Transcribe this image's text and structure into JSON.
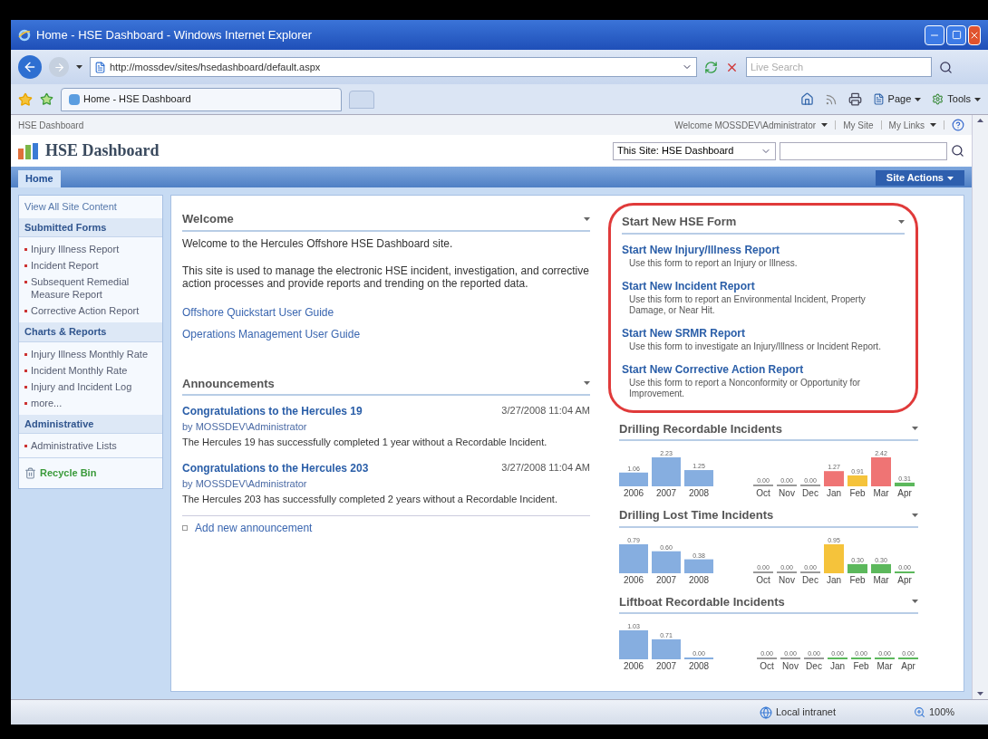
{
  "window": {
    "title": "Home - HSE Dashboard - Windows Internet Explorer"
  },
  "address_bar": {
    "url": "http://mossdev/sites/hsedashboard/default.aspx"
  },
  "search": {
    "placeholder": "Live Search"
  },
  "tabs": [
    {
      "label": "Home - HSE Dashboard",
      "selected": true
    }
  ],
  "command_bar": [
    "Page",
    "Tools"
  ],
  "site": {
    "breadcrumb": "HSE Dashboard",
    "welcome": "Welcome MOSSDEV\\Administrator",
    "top_links": [
      "My Site",
      "My Links"
    ],
    "title": "HSE Dashboard",
    "search_scope": "This Site: HSE Dashboard"
  },
  "top_nav": [
    {
      "label": "Home",
      "selected": true
    }
  ],
  "site_actions": "Site Actions",
  "quick_launch": {
    "view_all": "View All Site Content",
    "sections": [
      {
        "heading": "Submitted Forms",
        "items": [
          "Injury Illness Report",
          "Incident Report",
          "Subsequent Remedial Measure Report",
          "Corrective Action Report"
        ]
      },
      {
        "heading": "Charts & Reports",
        "items": [
          "Injury Illness Monthly Rate",
          "Incident Monthly Rate",
          "Injury and Incident Log",
          "more..."
        ]
      },
      {
        "heading": "Administrative",
        "items": [
          "Administrative Lists"
        ]
      }
    ],
    "recycle_bin": "Recycle Bin"
  },
  "welcome": {
    "title": "Welcome",
    "paragraphs": [
      "Welcome to the Hercules Offshore HSE Dashboard site.",
      "This site is used to manage the electronic HSE incident, investigation, and corrective action processes and provide reports and trending on the reported data."
    ],
    "links": [
      "Offshore Quickstart User Guide",
      "Operations Management User Guide"
    ]
  },
  "announcements": {
    "title": "Announcements",
    "items": [
      {
        "title": "Congratulations to the Hercules 19",
        "date": "3/27/2008 11:04 AM",
        "author": "by MOSSDEV\\Administrator",
        "body": "The Hercules 19 has successfully completed 1 year without a Recordable Incident."
      },
      {
        "title": "Congratulations to the Hercules 203",
        "date": "3/27/2008 11:04 AM",
        "author": "by MOSSDEV\\Administrator",
        "body": "The Hercules 203 has successfully completed 2 years without a Recordable Incident."
      }
    ],
    "add": "Add new announcement"
  },
  "hse_form": {
    "title": "Start New HSE Form",
    "highlighted": true,
    "items": [
      {
        "title": "Start New Injury/Illness Report",
        "description": "Use this form to report an Injury or Illness."
      },
      {
        "title": "Start New Incident Report",
        "description": "Use this form to report an Environmental Incident, Property Damage, or Near Hit."
      },
      {
        "title": "Start New SRMR Report",
        "description": "Use this form to investigate an Injury/Illness or Incident Report."
      },
      {
        "title": "Start New Corrective Action Report",
        "description": "Use this form to report a Nonconformity or Opportunity for Improvement."
      }
    ]
  },
  "charts": [
    {
      "title": "Drilling Recordable Incidents",
      "yearly": {
        "chart_data": {
          "type": "bar",
          "categories": [
            "2006",
            "2007",
            "2008"
          ],
          "data_labels": true,
          "series": [
            {
              "color": "#86aee0",
              "values": [
                1.06,
                2.23,
                1.25
              ],
              "value_labels": [
                "1.06",
                "2.23",
                "1.25"
              ]
            }
          ]
        }
      },
      "monthly": {
        "chart_data": {
          "type": "bar",
          "stacked": true,
          "data_labels": true,
          "categories": [
            "Oct",
            "Nov",
            "Dec",
            "Jan",
            "Feb",
            "Mar",
            "Apr"
          ],
          "series": [
            {
              "color": "#999999",
              "values": [
                0,
                0,
                0,
                null,
                null,
                null,
                null
              ],
              "value_labels": [
                "0.00",
                "0.00",
                "0.00",
                null,
                null,
                null,
                null
              ]
            },
            {
              "color": "#ef7474",
              "values": [
                null,
                null,
                null,
                1.27,
                null,
                2.42,
                null
              ],
              "value_labels": [
                null,
                null,
                null,
                "1.27",
                null,
                "2.42",
                null
              ]
            },
            {
              "color": "#f5c33b",
              "values": [
                null,
                null,
                null,
                null,
                0.91,
                null,
                null
              ],
              "value_labels": [
                null,
                null,
                null,
                null,
                "0.91",
                null,
                null
              ]
            },
            {
              "color": "#5cb85c",
              "values": [
                null,
                null,
                null,
                null,
                null,
                null,
                0.31
              ],
              "value_labels": [
                null,
                null,
                null,
                null,
                null,
                null,
                "0.31"
              ]
            }
          ]
        }
      }
    },
    {
      "title": "Drilling Lost Time Incidents",
      "yearly": {
        "chart_data": {
          "type": "bar",
          "categories": [
            "2006",
            "2007",
            "2008"
          ],
          "data_labels": true,
          "series": [
            {
              "color": "#86aee0",
              "values": [
                0.79,
                0.6,
                0.38
              ],
              "value_labels": [
                "0.79",
                "0.60",
                "0.38"
              ]
            }
          ]
        }
      },
      "monthly": {
        "chart_data": {
          "type": "bar",
          "stacked": true,
          "data_labels": true,
          "categories": [
            "Oct",
            "Nov",
            "Dec",
            "Jan",
            "Feb",
            "Mar",
            "Apr"
          ],
          "series": [
            {
              "color": "#999999",
              "values": [
                0,
                0,
                0,
                null,
                null,
                null,
                null
              ],
              "value_labels": [
                "0.00",
                "0.00",
                "0.00",
                null,
                null,
                null,
                null
              ]
            },
            {
              "color": "#f5c33b",
              "values": [
                null,
                null,
                null,
                0.95,
                null,
                null,
                null
              ],
              "value_labels": [
                null,
                null,
                null,
                "0.95",
                null,
                null,
                null
              ]
            },
            {
              "color": "#5cb85c",
              "values": [
                null,
                null,
                null,
                null,
                0.3,
                0.3,
                0
              ],
              "value_labels": [
                null,
                null,
                null,
                null,
                "0.30",
                "0.30",
                "0.00"
              ]
            }
          ]
        }
      }
    },
    {
      "title": "Liftboat Recordable Incidents",
      "yearly": {
        "chart_data": {
          "type": "bar",
          "categories": [
            "2006",
            "2007",
            "2008"
          ],
          "data_labels": true,
          "series": [
            {
              "color": "#86aee0",
              "values": [
                1.03,
                0.71,
                0
              ],
              "value_labels": [
                "1.03",
                "0.71",
                "0.00"
              ]
            }
          ]
        }
      },
      "monthly": {
        "zero_bars": [
          {
            "month": "Oct",
            "reading": "0.00",
            "color": "#999999"
          },
          {
            "month": "Nov",
            "reading": "0.00",
            "color": "#999999"
          },
          {
            "month": "Dec",
            "reading": "0.00",
            "color": "#999999"
          },
          {
            "month": "Jan",
            "reading": "0.00",
            "color": "#5cb85c"
          },
          {
            "month": "Feb",
            "reading": "0.00",
            "color": "#5cb85c"
          },
          {
            "month": "Mar",
            "reading": "0.00",
            "color": "#5cb85c"
          },
          {
            "month": "Apr",
            "reading": "0.00",
            "color": "#5cb85c"
          }
        ]
      }
    }
  ],
  "status_bar": {
    "zone": "Local intranet",
    "zoom": "100%"
  }
}
